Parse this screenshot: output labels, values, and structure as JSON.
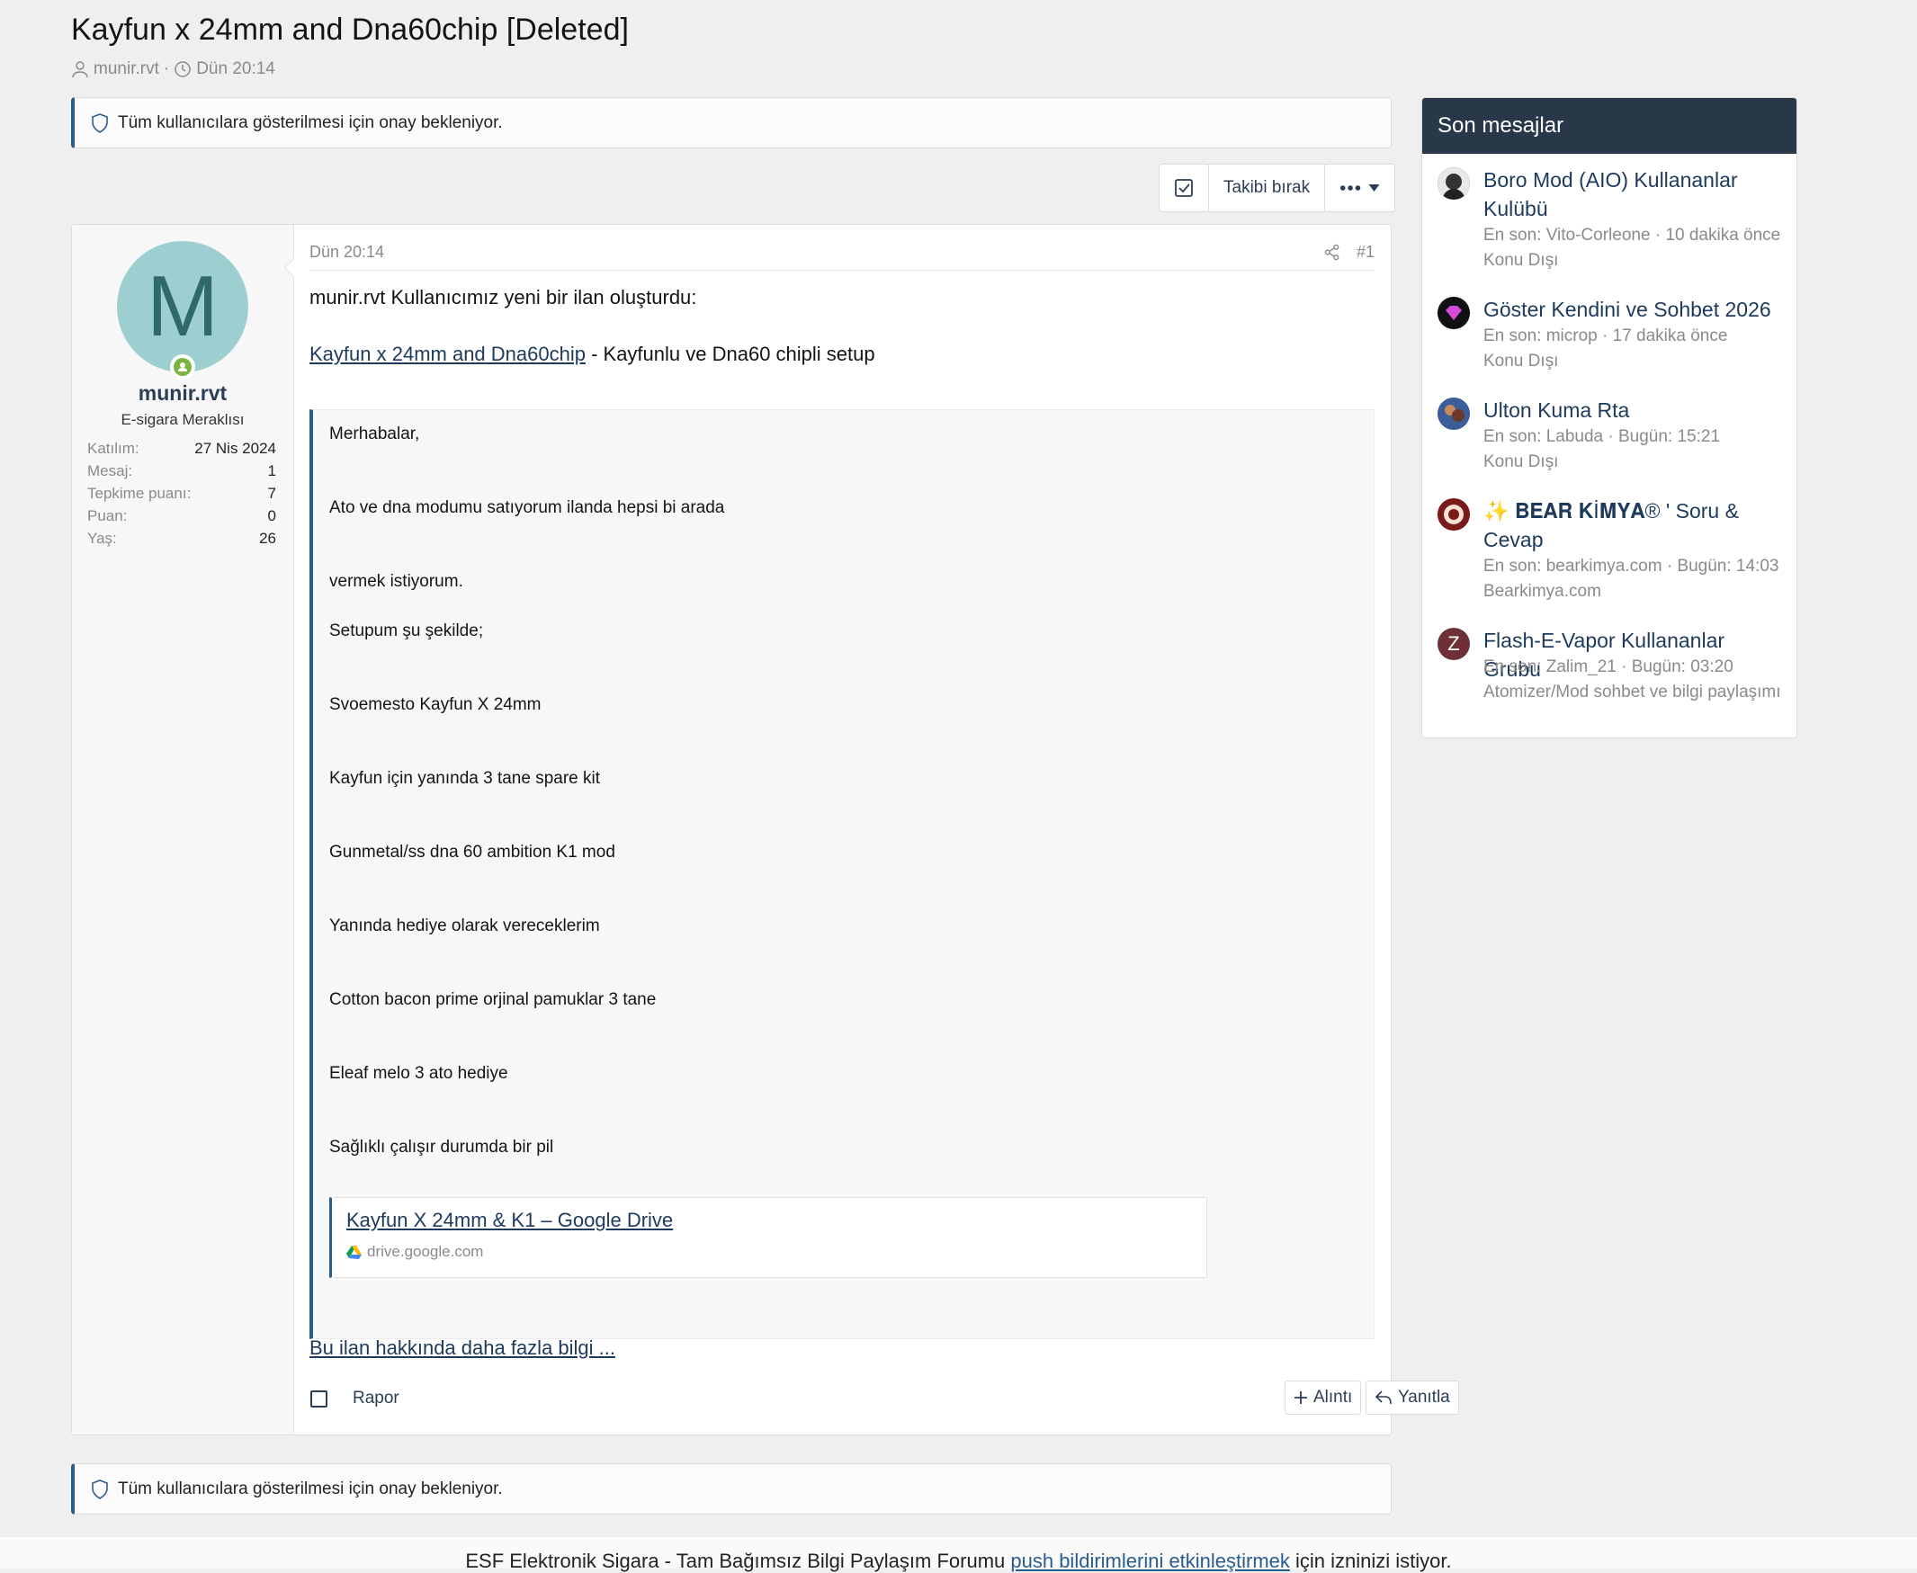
{
  "thread": {
    "title": "Kayfun x 24mm and Dna60chip [Deleted]",
    "author": "munir.rvt",
    "time": "Dün 20:14"
  },
  "notices": {
    "top": "Tüm kullanıcılara gösterilmesi için onay bekleniyor.",
    "bottom": "Tüm kullanıcılara gösterilmesi için onay bekleniyor."
  },
  "toolbar": {
    "unwatch_label": "Takibi bırak"
  },
  "post": {
    "user": {
      "avatar_letter": "M",
      "name": "munir.rvt",
      "title": "E-sigara Meraklısı",
      "stats": [
        {
          "label": "Katılım:",
          "value": "27 Nis 2024"
        },
        {
          "label": "Mesaj:",
          "value": "1"
        },
        {
          "label": "Tepkime puanı:",
          "value": "7"
        },
        {
          "label": "Puan:",
          "value": "0"
        },
        {
          "label": "Yaş:",
          "value": "26"
        }
      ]
    },
    "date": "Dün 20:14",
    "number": "#1",
    "intro": "munir.rvt Kullanıcımız yeni bir ilan oluşturdu:",
    "listing_link": "Kayfun x 24mm and Dna60chip",
    "listing_desc": " - Kayfunlu ve Dna60 chipli setup",
    "quote_lines": [
      "Merhabalar,",
      "Ato ve dna modumu satıyorum ilanda hepsi bi arada",
      "vermek istiyorum.",
      "Setupum şu şekilde;",
      "Svoemesto Kayfun X 24mm",
      "Kayfun için yanında 3 tane spare kit",
      "Gunmetal/ss dna 60 ambition K1 mod",
      "Yanında hediye olarak vereceklerim",
      "Cotton bacon prime orjinal pamuklar 3 tane",
      "Eleaf melo 3 ato hediye",
      "Sağlıklı çalışır durumda bir pil"
    ],
    "embed": {
      "title": "Kayfun X 24mm & K1 – Google Drive",
      "domain": "drive.google.com"
    },
    "more_link": "Bu ilan hakkında daha fazla bilgi ...",
    "report_label": "Rapor",
    "quote_label": "Alıntı",
    "reply_label": "Yanıtla"
  },
  "sidebar": {
    "title": "Son mesajlar",
    "threads": [
      {
        "title": "Boro Mod (AIO) Kullananlar Kulübü",
        "meta": "En son: Vito-Corleone · 10 dakika önce",
        "forum": "Konu Dışı"
      },
      {
        "title": "Göster Kendini ve Sohbet 2026",
        "meta": "En son: microp · 17 dakika önce",
        "forum": "Konu Dışı"
      },
      {
        "title": "Ulton Kuma Rta",
        "meta": "En son: Labuda · Bugün: 15:21",
        "forum": "Konu Dışı"
      },
      {
        "title": "✨ 𝐁𝐄𝐀𝐑 𝐊İ𝐌𝐘𝐀® ' Soru & Cevap",
        "meta": "En son: bearkimya.com · Bugün: 14:03",
        "forum": "Bearkimya.com"
      },
      {
        "title": "Flash-E-Vapor Kullananlar Grubu",
        "meta": "En son: Zalim_21 · Bugün: 03:20",
        "forum": "Atomizer/Mod sohbet ve bilgi paylaşımı",
        "avatar_letter": "Z"
      }
    ]
  },
  "push_bar": {
    "prefix": "ESF Elektronik Sigara - Tam Bağımsız Bilgi Paylaşım Forumu ",
    "link": "push bildirimlerini etkinleştirmek",
    "suffix": " için izninizi istiyor."
  }
}
